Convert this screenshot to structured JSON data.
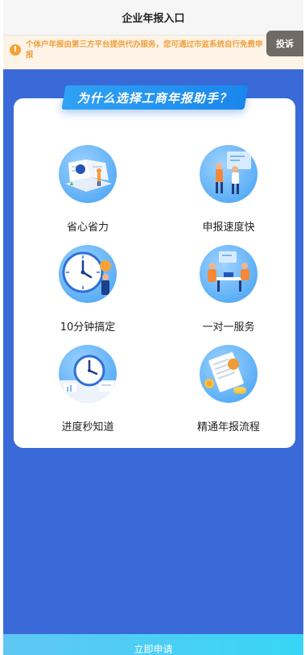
{
  "header": {
    "title": "企业年报入口"
  },
  "notice": {
    "icon": "info-circle-icon",
    "text": "个体户年报由第三方平台提供代办服务，您可通过市监系统自行免费申报"
  },
  "complaint_button": {
    "label": "投诉"
  },
  "section": {
    "banner_title": "为什么选择工商年报助手？"
  },
  "features": [
    {
      "label": "省心省力",
      "icon": "book-worker-icon"
    },
    {
      "label": "申报速度快",
      "icon": "team-presentation-icon"
    },
    {
      "label": "10分钟搞定",
      "icon": "clock-icon"
    },
    {
      "label": "一对一服务",
      "icon": "consultation-icon"
    },
    {
      "label": "进度秒知道",
      "icon": "clock-calendar-icon"
    },
    {
      "label": "精通年报流程",
      "icon": "document-coins-icon"
    }
  ],
  "footer": {
    "apply_label": "立即申请"
  },
  "colors": {
    "background": "#3a6ad8",
    "accent": "#1a86ec",
    "notice_text": "#f0a040",
    "button": "#38d5f7"
  }
}
